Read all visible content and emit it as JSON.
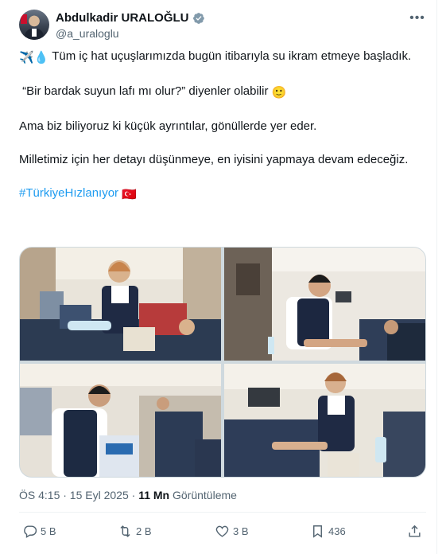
{
  "author": {
    "display_name": "Abdulkadir URALOĞLU",
    "handle": "@a_uraloglu"
  },
  "post": {
    "line1_emoji": "✈️💧",
    "line1": " Tüm iç hat uçuşlarımızda bugün itibarıyla su ikram etmeye başladık.",
    "line2": " “Bir bardak suyun lafı mı olur?” diyenler olabilir ",
    "line2_emoji": "🙂",
    "line3": "Ama biz biliyoruz ki küçük ayrıntılar, gönüllerde yer eder.",
    "line4": "Milletimiz için her detayı düşünmeye, en iyisini yapmaya devam edeceğiz.",
    "hashtag": "#TürkiyeHızlanıyor",
    "flag_emoji": "🇹🇷"
  },
  "meta": {
    "time": "ÖS 4:15 · 15 Eyl 2025 · ",
    "views_count": "11 Mn",
    "views_label": " Görüntüleme"
  },
  "actions": {
    "replies": "5 B",
    "reposts": "2 B",
    "likes": "3 B",
    "bookmarks": "436"
  },
  "colors": {
    "accent": "#1d9bf0",
    "text": "#0f1419",
    "muted": "#536471"
  }
}
